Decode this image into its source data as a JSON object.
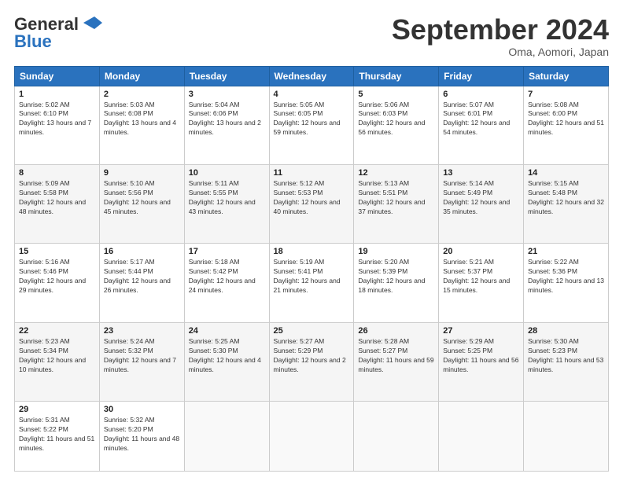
{
  "logo": {
    "line1": "General",
    "line2": "Blue"
  },
  "title": "September 2024",
  "location": "Oma, Aomori, Japan",
  "weekdays": [
    "Sunday",
    "Monday",
    "Tuesday",
    "Wednesday",
    "Thursday",
    "Friday",
    "Saturday"
  ],
  "days": [
    {
      "date": "",
      "info": ""
    },
    {
      "date": "",
      "info": ""
    },
    {
      "date": "",
      "info": ""
    },
    {
      "date": "",
      "info": ""
    },
    {
      "date": "",
      "info": ""
    },
    {
      "date": "",
      "info": ""
    },
    {
      "date": "7",
      "sunrise": "Sunrise: 5:08 AM",
      "sunset": "Sunset: 6:00 PM",
      "daylight": "Daylight: 12 hours and 51 minutes."
    },
    {
      "date": "1",
      "sunrise": "Sunrise: 5:02 AM",
      "sunset": "Sunset: 6:10 PM",
      "daylight": "Daylight: 13 hours and 7 minutes."
    },
    {
      "date": "2",
      "sunrise": "Sunrise: 5:03 AM",
      "sunset": "Sunset: 6:08 PM",
      "daylight": "Daylight: 13 hours and 4 minutes."
    },
    {
      "date": "3",
      "sunrise": "Sunrise: 5:04 AM",
      "sunset": "Sunset: 6:06 PM",
      "daylight": "Daylight: 13 hours and 2 minutes."
    },
    {
      "date": "4",
      "sunrise": "Sunrise: 5:05 AM",
      "sunset": "Sunset: 6:05 PM",
      "daylight": "Daylight: 12 hours and 59 minutes."
    },
    {
      "date": "5",
      "sunrise": "Sunrise: 5:06 AM",
      "sunset": "Sunset: 6:03 PM",
      "daylight": "Daylight: 12 hours and 56 minutes."
    },
    {
      "date": "6",
      "sunrise": "Sunrise: 5:07 AM",
      "sunset": "Sunset: 6:01 PM",
      "daylight": "Daylight: 12 hours and 54 minutes."
    },
    {
      "date": "7",
      "sunrise": "Sunrise: 5:08 AM",
      "sunset": "Sunset: 6:00 PM",
      "daylight": "Daylight: 12 hours and 51 minutes."
    },
    {
      "date": "8",
      "sunrise": "Sunrise: 5:09 AM",
      "sunset": "Sunset: 5:58 PM",
      "daylight": "Daylight: 12 hours and 48 minutes."
    },
    {
      "date": "9",
      "sunrise": "Sunrise: 5:10 AM",
      "sunset": "Sunset: 5:56 PM",
      "daylight": "Daylight: 12 hours and 45 minutes."
    },
    {
      "date": "10",
      "sunrise": "Sunrise: 5:11 AM",
      "sunset": "Sunset: 5:55 PM",
      "daylight": "Daylight: 12 hours and 43 minutes."
    },
    {
      "date": "11",
      "sunrise": "Sunrise: 5:12 AM",
      "sunset": "Sunset: 5:53 PM",
      "daylight": "Daylight: 12 hours and 40 minutes."
    },
    {
      "date": "12",
      "sunrise": "Sunrise: 5:13 AM",
      "sunset": "Sunset: 5:51 PM",
      "daylight": "Daylight: 12 hours and 37 minutes."
    },
    {
      "date": "13",
      "sunrise": "Sunrise: 5:14 AM",
      "sunset": "Sunset: 5:49 PM",
      "daylight": "Daylight: 12 hours and 35 minutes."
    },
    {
      "date": "14",
      "sunrise": "Sunrise: 5:15 AM",
      "sunset": "Sunset: 5:48 PM",
      "daylight": "Daylight: 12 hours and 32 minutes."
    },
    {
      "date": "15",
      "sunrise": "Sunrise: 5:16 AM",
      "sunset": "Sunset: 5:46 PM",
      "daylight": "Daylight: 12 hours and 29 minutes."
    },
    {
      "date": "16",
      "sunrise": "Sunrise: 5:17 AM",
      "sunset": "Sunset: 5:44 PM",
      "daylight": "Daylight: 12 hours and 26 minutes."
    },
    {
      "date": "17",
      "sunrise": "Sunrise: 5:18 AM",
      "sunset": "Sunset: 5:42 PM",
      "daylight": "Daylight: 12 hours and 24 minutes."
    },
    {
      "date": "18",
      "sunrise": "Sunrise: 5:19 AM",
      "sunset": "Sunset: 5:41 PM",
      "daylight": "Daylight: 12 hours and 21 minutes."
    },
    {
      "date": "19",
      "sunrise": "Sunrise: 5:20 AM",
      "sunset": "Sunset: 5:39 PM",
      "daylight": "Daylight: 12 hours and 18 minutes."
    },
    {
      "date": "20",
      "sunrise": "Sunrise: 5:21 AM",
      "sunset": "Sunset: 5:37 PM",
      "daylight": "Daylight: 12 hours and 15 minutes."
    },
    {
      "date": "21",
      "sunrise": "Sunrise: 5:22 AM",
      "sunset": "Sunset: 5:36 PM",
      "daylight": "Daylight: 12 hours and 13 minutes."
    },
    {
      "date": "22",
      "sunrise": "Sunrise: 5:23 AM",
      "sunset": "Sunset: 5:34 PM",
      "daylight": "Daylight: 12 hours and 10 minutes."
    },
    {
      "date": "23",
      "sunrise": "Sunrise: 5:24 AM",
      "sunset": "Sunset: 5:32 PM",
      "daylight": "Daylight: 12 hours and 7 minutes."
    },
    {
      "date": "24",
      "sunrise": "Sunrise: 5:25 AM",
      "sunset": "Sunset: 5:30 PM",
      "daylight": "Daylight: 12 hours and 4 minutes."
    },
    {
      "date": "25",
      "sunrise": "Sunrise: 5:27 AM",
      "sunset": "Sunset: 5:29 PM",
      "daylight": "Daylight: 12 hours and 2 minutes."
    },
    {
      "date": "26",
      "sunrise": "Sunrise: 5:28 AM",
      "sunset": "Sunset: 5:27 PM",
      "daylight": "Daylight: 11 hours and 59 minutes."
    },
    {
      "date": "27",
      "sunrise": "Sunrise: 5:29 AM",
      "sunset": "Sunset: 5:25 PM",
      "daylight": "Daylight: 11 hours and 56 minutes."
    },
    {
      "date": "28",
      "sunrise": "Sunrise: 5:30 AM",
      "sunset": "Sunset: 5:23 PM",
      "daylight": "Daylight: 11 hours and 53 minutes."
    },
    {
      "date": "29",
      "sunrise": "Sunrise: 5:31 AM",
      "sunset": "Sunset: 5:22 PM",
      "daylight": "Daylight: 11 hours and 51 minutes."
    },
    {
      "date": "30",
      "sunrise": "Sunrise: 5:32 AM",
      "sunset": "Sunset: 5:20 PM",
      "daylight": "Daylight: 11 hours and 48 minutes."
    }
  ]
}
